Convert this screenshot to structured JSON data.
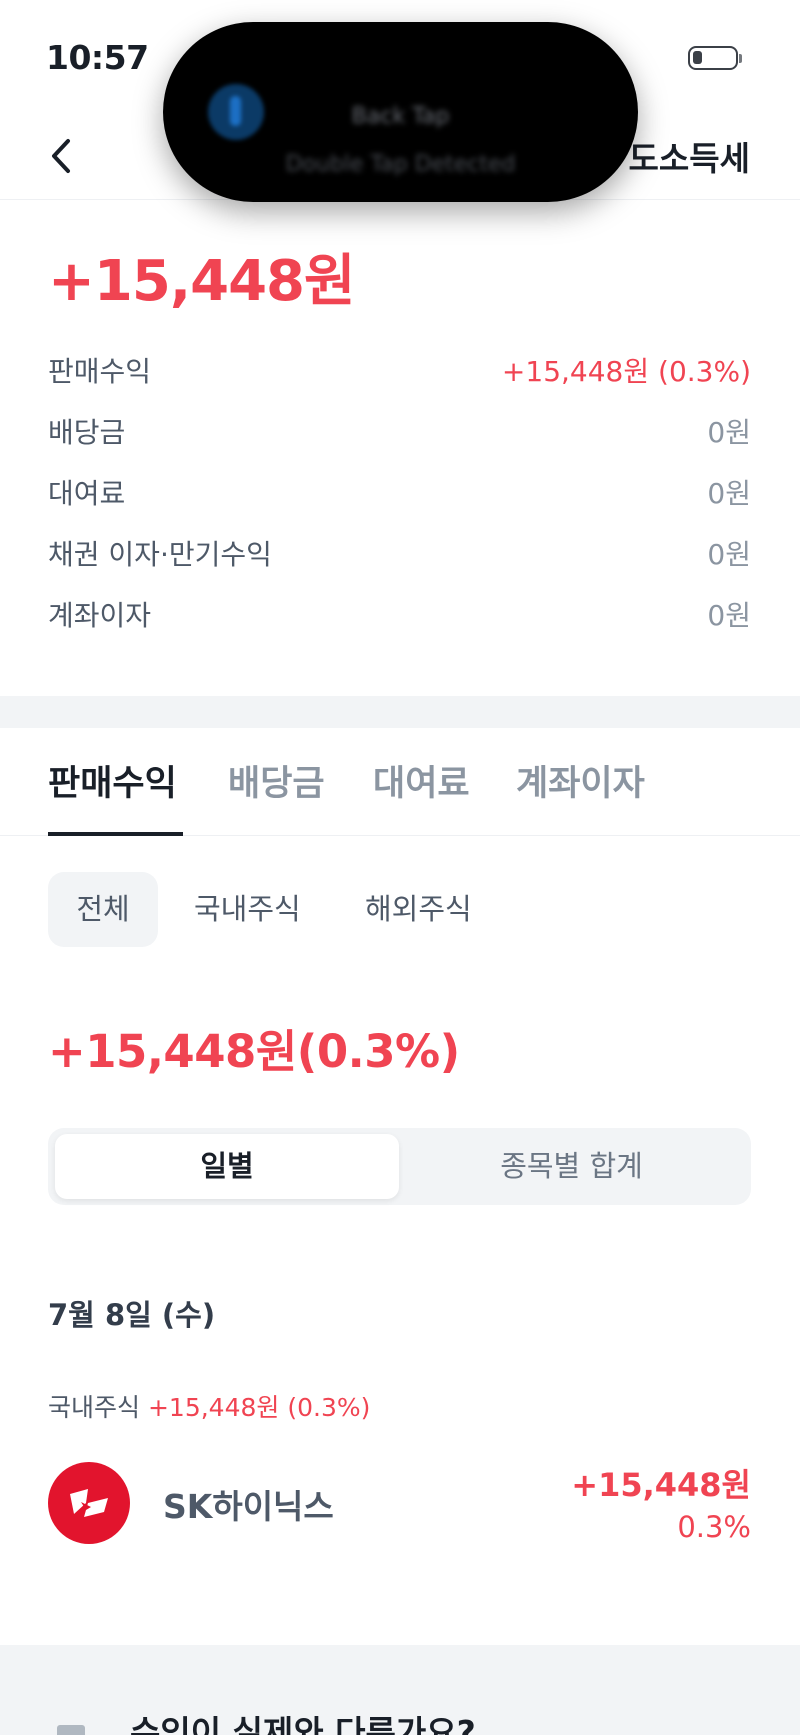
{
  "status_bar": {
    "time": "10:57"
  },
  "notification": {
    "title": "Back Tap",
    "subtitle": "Double Tap Detected",
    "icon": "info-icon"
  },
  "header": {
    "back_icon": "chevron-left-icon",
    "right_label": "도소득세"
  },
  "summary": {
    "total": "+15,448원",
    "rows": [
      {
        "label": "판매수익",
        "value": "+15,448원 (0.3%)"
      },
      {
        "label": "배당금",
        "value": "0원"
      },
      {
        "label": "대여료",
        "value": "0원"
      },
      {
        "label": "채권 이자·만기수익",
        "value": "0원"
      },
      {
        "label": "계좌이자",
        "value": "0원"
      }
    ]
  },
  "tabs": [
    {
      "label": "판매수익",
      "active": true
    },
    {
      "label": "배당금"
    },
    {
      "label": "대여료"
    },
    {
      "label": "계좌이자"
    }
  ],
  "chips": [
    {
      "label": "전체",
      "active": true
    },
    {
      "label": "국내주식"
    },
    {
      "label": "해외주식"
    }
  ],
  "sub_total": "+15,448원(0.3%)",
  "segmented": {
    "daily": "일별",
    "by_stock": "종목별 합계"
  },
  "day": {
    "date": "7월 8일 (수)",
    "market_label": "국내주식",
    "market_value": "+15,448원 (0.3%)",
    "stock": {
      "name": "SK하이닉스",
      "amount": "+15,448원",
      "percent": "0.3%",
      "logo": "sk-hynix-logo"
    }
  },
  "footer": {
    "text": "수익이 실제와 다른가요?"
  },
  "colors": {
    "positive": "#f04452",
    "text_primary": "#191f28",
    "text_secondary": "#4e5968",
    "muted": "#8b95a1",
    "band": "#f2f4f6"
  }
}
